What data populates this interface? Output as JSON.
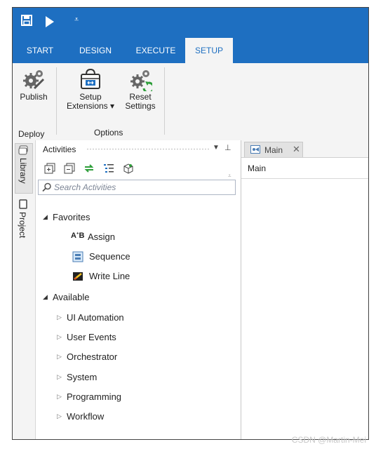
{
  "tabs": [
    "START",
    "DESIGN",
    "EXECUTE",
    "SETUP"
  ],
  "ribbon": {
    "publish_label": "Publish",
    "setup_ext_line1": "Setup",
    "setup_ext_line2": "Extensions ▾",
    "reset_line1": "Reset",
    "reset_line2": "Settings",
    "group_deploy": "Deploy",
    "group_options": "Options"
  },
  "side": {
    "library_label": "Library",
    "project_label": "Project"
  },
  "activities": {
    "title": "Activities",
    "search_placeholder": "Search Activities",
    "favorites_label": "Favorites",
    "favorites": [
      "Assign",
      "Sequence",
      "Write Line"
    ],
    "available_label": "Available",
    "available": [
      "UI Automation",
      "User Events",
      "Orchestrator",
      "System",
      "Programming",
      "Workflow"
    ]
  },
  "doc": {
    "tab_label": "Main",
    "breadcrumb": "Main"
  },
  "watermark": "CSDN @Martin-Mei",
  "colors": {
    "accent": "#1e6fc1",
    "ribbon_bg": "#f4f4f4"
  }
}
